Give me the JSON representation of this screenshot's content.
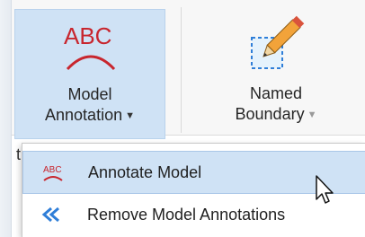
{
  "ribbon": {
    "model_annotation": {
      "abc_text": "ABC",
      "label_line1": "Model",
      "label_line2": "Annotation",
      "dropdown_glyph": "▼"
    },
    "named_boundary": {
      "label_line1": "Named",
      "label_line2": "Boundary",
      "dropdown_glyph": "▼"
    }
  },
  "left_fragment": "t",
  "menu": {
    "items": [
      {
        "label": "Annotate Model",
        "icon": "annotate-abc-icon",
        "hovered": true
      },
      {
        "label": "Remove Model Annotations",
        "icon": "remove-annotations-icon",
        "hovered": false
      }
    ]
  },
  "colors": {
    "accent_red": "#c8262e",
    "accent_blue": "#2f7ed8",
    "hover_bg": "#cfe2f5",
    "hover_border": "#a9c7e8"
  }
}
